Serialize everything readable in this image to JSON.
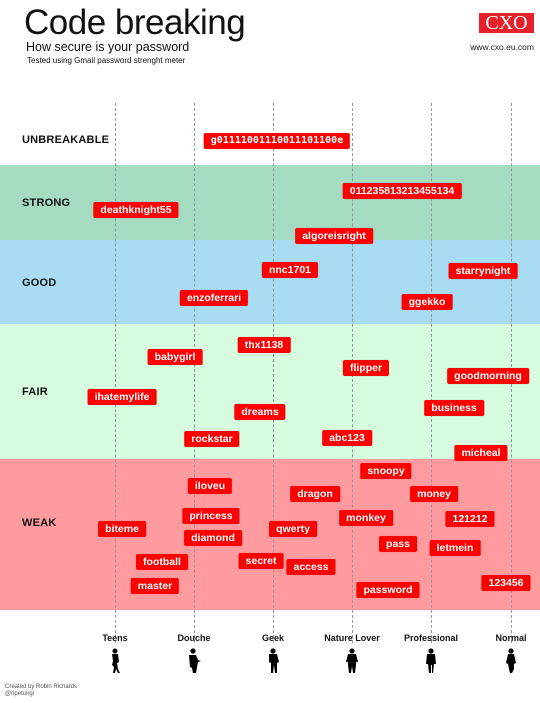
{
  "header": {
    "title": "Code breaking",
    "subtitle": "How secure is your password",
    "note": "Tested using Gmail password strenght meter",
    "brand": "CXO",
    "brand_url": "www.cxo.eu.com"
  },
  "credit": {
    "line1": "Created by Robin Richards",
    "line2": "@ripetungi"
  },
  "colors": {
    "badge": "#ff0000",
    "unbreakable": "#ffffff",
    "strong": "#a5dbc0",
    "good": "#a8dcf2",
    "fair": "#d6fbdf",
    "weak": "#ff9a9e"
  },
  "chart_data": {
    "type": "scatter",
    "title": "Code breaking",
    "subtitle": "How secure is your password",
    "xlabel": "",
    "ylabel": "",
    "grid": "vertical dashed lines per category",
    "strength_levels": [
      "UNBREAKABLE",
      "STRONG",
      "GOOD",
      "FAIR",
      "WEAK"
    ],
    "categories": [
      "Teens",
      "Douche",
      "Geek",
      "Nature Lover",
      "Professional",
      "Normal"
    ],
    "category_icons": [
      "teen-silhouette-icon",
      "douche-silhouette-icon",
      "geek-silhouette-icon",
      "nature-lover-silhouette-icon",
      "professional-silhouette-icon",
      "normal-silhouette-icon"
    ],
    "passwords": [
      {
        "text": "g0111100111001110 1100e",
        "strength": "UNBREAKABLE",
        "mono": true
      },
      {
        "text": "deathknight55",
        "strength": "STRONG"
      },
      {
        "text": "011235813213455134",
        "strength": "STRONG"
      },
      {
        "text": "algoreisright",
        "strength": "STRONG"
      },
      {
        "text": "nnc1701",
        "strength": "GOOD"
      },
      {
        "text": "starrynight",
        "strength": "GOOD"
      },
      {
        "text": "enzoferrari",
        "strength": "GOOD"
      },
      {
        "text": "ggekko",
        "strength": "GOOD"
      },
      {
        "text": "thx1138",
        "strength": "FAIR"
      },
      {
        "text": "babygirl",
        "strength": "FAIR"
      },
      {
        "text": "flipper",
        "strength": "FAIR"
      },
      {
        "text": "goodmorning",
        "strength": "FAIR"
      },
      {
        "text": "ihatemylife",
        "strength": "FAIR"
      },
      {
        "text": "business",
        "strength": "FAIR"
      },
      {
        "text": "dreams",
        "strength": "FAIR"
      },
      {
        "text": "rockstar",
        "strength": "FAIR"
      },
      {
        "text": "abc123",
        "strength": "FAIR"
      },
      {
        "text": "micheal",
        "strength": "FAIR"
      },
      {
        "text": "snoopy",
        "strength": "WEAK"
      },
      {
        "text": "iloveu",
        "strength": "WEAK"
      },
      {
        "text": "dragon",
        "strength": "WEAK"
      },
      {
        "text": "money",
        "strength": "WEAK"
      },
      {
        "text": "princess",
        "strength": "WEAK"
      },
      {
        "text": "monkey",
        "strength": "WEAK"
      },
      {
        "text": "121212",
        "strength": "WEAK"
      },
      {
        "text": "biteme",
        "strength": "WEAK"
      },
      {
        "text": "qwerty",
        "strength": "WEAK"
      },
      {
        "text": "diamond",
        "strength": "WEAK"
      },
      {
        "text": "pass",
        "strength": "WEAK"
      },
      {
        "text": "letmein",
        "strength": "WEAK"
      },
      {
        "text": "football",
        "strength": "WEAK"
      },
      {
        "text": "secret",
        "strength": "WEAK"
      },
      {
        "text": "access",
        "strength": "WEAK"
      },
      {
        "text": "123456",
        "strength": "WEAK"
      },
      {
        "text": "master",
        "strength": "WEAK"
      },
      {
        "text": "password",
        "strength": "WEAK"
      }
    ]
  }
}
